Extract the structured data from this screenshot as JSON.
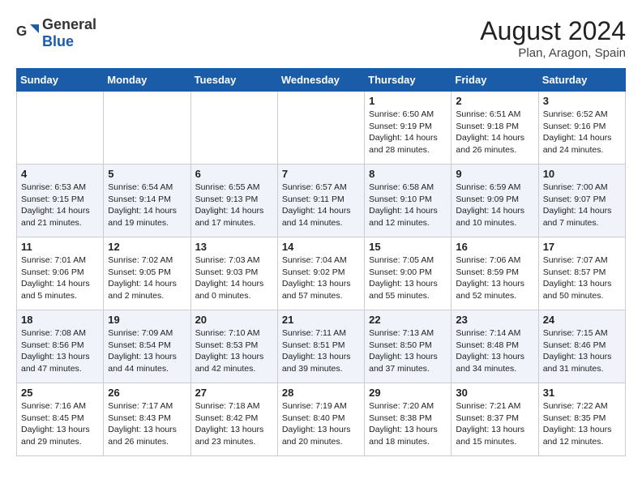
{
  "header": {
    "logo_general": "General",
    "logo_blue": "Blue",
    "month_year": "August 2024",
    "location": "Plan, Aragon, Spain"
  },
  "days_of_week": [
    "Sunday",
    "Monday",
    "Tuesday",
    "Wednesday",
    "Thursday",
    "Friday",
    "Saturday"
  ],
  "weeks": [
    {
      "days": [
        {
          "number": "",
          "info": ""
        },
        {
          "number": "",
          "info": ""
        },
        {
          "number": "",
          "info": ""
        },
        {
          "number": "",
          "info": ""
        },
        {
          "number": "1",
          "info": "Sunrise: 6:50 AM\nSunset: 9:19 PM\nDaylight: 14 hours and 28 minutes."
        },
        {
          "number": "2",
          "info": "Sunrise: 6:51 AM\nSunset: 9:18 PM\nDaylight: 14 hours and 26 minutes."
        },
        {
          "number": "3",
          "info": "Sunrise: 6:52 AM\nSunset: 9:16 PM\nDaylight: 14 hours and 24 minutes."
        }
      ]
    },
    {
      "days": [
        {
          "number": "4",
          "info": "Sunrise: 6:53 AM\nSunset: 9:15 PM\nDaylight: 14 hours and 21 minutes."
        },
        {
          "number": "5",
          "info": "Sunrise: 6:54 AM\nSunset: 9:14 PM\nDaylight: 14 hours and 19 minutes."
        },
        {
          "number": "6",
          "info": "Sunrise: 6:55 AM\nSunset: 9:13 PM\nDaylight: 14 hours and 17 minutes."
        },
        {
          "number": "7",
          "info": "Sunrise: 6:57 AM\nSunset: 9:11 PM\nDaylight: 14 hours and 14 minutes."
        },
        {
          "number": "8",
          "info": "Sunrise: 6:58 AM\nSunset: 9:10 PM\nDaylight: 14 hours and 12 minutes."
        },
        {
          "number": "9",
          "info": "Sunrise: 6:59 AM\nSunset: 9:09 PM\nDaylight: 14 hours and 10 minutes."
        },
        {
          "number": "10",
          "info": "Sunrise: 7:00 AM\nSunset: 9:07 PM\nDaylight: 14 hours and 7 minutes."
        }
      ]
    },
    {
      "days": [
        {
          "number": "11",
          "info": "Sunrise: 7:01 AM\nSunset: 9:06 PM\nDaylight: 14 hours and 5 minutes."
        },
        {
          "number": "12",
          "info": "Sunrise: 7:02 AM\nSunset: 9:05 PM\nDaylight: 14 hours and 2 minutes."
        },
        {
          "number": "13",
          "info": "Sunrise: 7:03 AM\nSunset: 9:03 PM\nDaylight: 14 hours and 0 minutes."
        },
        {
          "number": "14",
          "info": "Sunrise: 7:04 AM\nSunset: 9:02 PM\nDaylight: 13 hours and 57 minutes."
        },
        {
          "number": "15",
          "info": "Sunrise: 7:05 AM\nSunset: 9:00 PM\nDaylight: 13 hours and 55 minutes."
        },
        {
          "number": "16",
          "info": "Sunrise: 7:06 AM\nSunset: 8:59 PM\nDaylight: 13 hours and 52 minutes."
        },
        {
          "number": "17",
          "info": "Sunrise: 7:07 AM\nSunset: 8:57 PM\nDaylight: 13 hours and 50 minutes."
        }
      ]
    },
    {
      "days": [
        {
          "number": "18",
          "info": "Sunrise: 7:08 AM\nSunset: 8:56 PM\nDaylight: 13 hours and 47 minutes."
        },
        {
          "number": "19",
          "info": "Sunrise: 7:09 AM\nSunset: 8:54 PM\nDaylight: 13 hours and 44 minutes."
        },
        {
          "number": "20",
          "info": "Sunrise: 7:10 AM\nSunset: 8:53 PM\nDaylight: 13 hours and 42 minutes."
        },
        {
          "number": "21",
          "info": "Sunrise: 7:11 AM\nSunset: 8:51 PM\nDaylight: 13 hours and 39 minutes."
        },
        {
          "number": "22",
          "info": "Sunrise: 7:13 AM\nSunset: 8:50 PM\nDaylight: 13 hours and 37 minutes."
        },
        {
          "number": "23",
          "info": "Sunrise: 7:14 AM\nSunset: 8:48 PM\nDaylight: 13 hours and 34 minutes."
        },
        {
          "number": "24",
          "info": "Sunrise: 7:15 AM\nSunset: 8:46 PM\nDaylight: 13 hours and 31 minutes."
        }
      ]
    },
    {
      "days": [
        {
          "number": "25",
          "info": "Sunrise: 7:16 AM\nSunset: 8:45 PM\nDaylight: 13 hours and 29 minutes."
        },
        {
          "number": "26",
          "info": "Sunrise: 7:17 AM\nSunset: 8:43 PM\nDaylight: 13 hours and 26 minutes."
        },
        {
          "number": "27",
          "info": "Sunrise: 7:18 AM\nSunset: 8:42 PM\nDaylight: 13 hours and 23 minutes."
        },
        {
          "number": "28",
          "info": "Sunrise: 7:19 AM\nSunset: 8:40 PM\nDaylight: 13 hours and 20 minutes."
        },
        {
          "number": "29",
          "info": "Sunrise: 7:20 AM\nSunset: 8:38 PM\nDaylight: 13 hours and 18 minutes."
        },
        {
          "number": "30",
          "info": "Sunrise: 7:21 AM\nSunset: 8:37 PM\nDaylight: 13 hours and 15 minutes."
        },
        {
          "number": "31",
          "info": "Sunrise: 7:22 AM\nSunset: 8:35 PM\nDaylight: 13 hours and 12 minutes."
        }
      ]
    }
  ]
}
